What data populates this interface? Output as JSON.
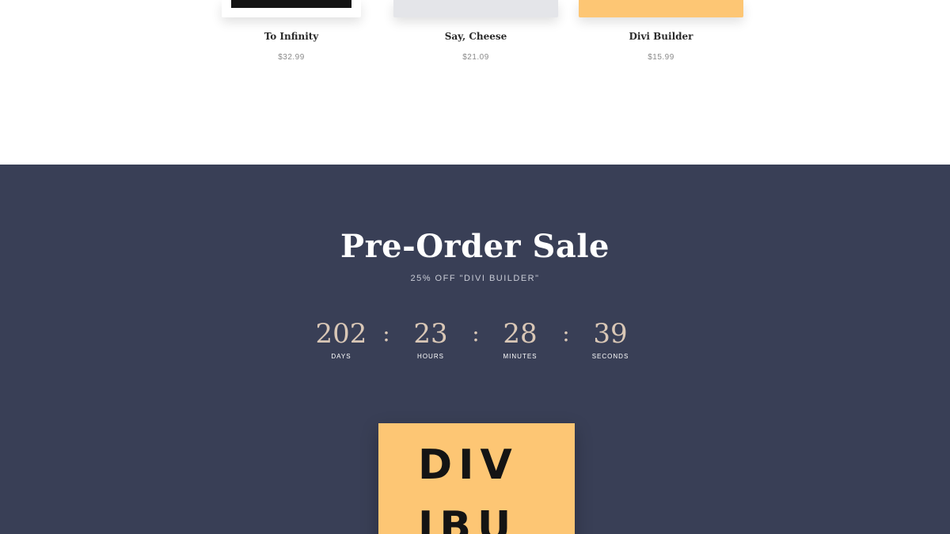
{
  "products": [
    {
      "name": "To Infinity",
      "price": "$32.99"
    },
    {
      "name": "Say, Cheese",
      "price": "$21.09"
    },
    {
      "name": "Divi Builder",
      "price": "$15.99"
    }
  ],
  "sale": {
    "title": "Pre-Order Sale",
    "subtitle": "25% OFF \"DIVI BUILDER\"",
    "countdown": {
      "days": {
        "value": "202",
        "label": "Days"
      },
      "hours": {
        "value": "23",
        "label": "Hours"
      },
      "minutes": {
        "value": "28",
        "label": "Minutes"
      },
      "seconds": {
        "value": "39",
        "label": "Seconds"
      },
      "separator": ":"
    },
    "book_cover": {
      "line1": "DIV",
      "line2": "IBU"
    }
  },
  "colors": {
    "banner_bg": "#393f56",
    "accent_yellow": "#fdc674",
    "countdown_value": "#d9c7b6"
  }
}
